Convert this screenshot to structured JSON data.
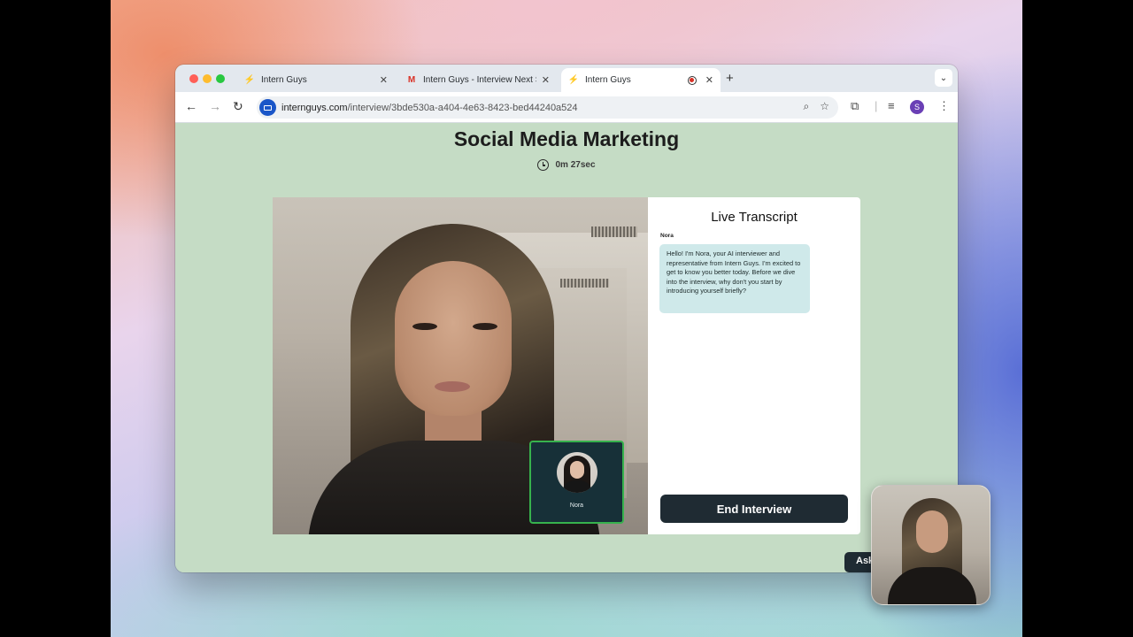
{
  "browser": {
    "tabs": [
      {
        "title": "Intern Guys",
        "favicon": "intern-guys-favicon"
      },
      {
        "title": "Intern Guys - Interview Next S",
        "favicon": "gmail-favicon"
      },
      {
        "title": "Intern Guys",
        "favicon": "intern-guys-favicon",
        "active": true
      }
    ],
    "url_domain": "internguys.com",
    "url_path": "/interview/3bde530a-a404-4e63-8423-bed44240a524",
    "profile_initial": "S"
  },
  "page": {
    "title": "Social Media Marketing",
    "timer": "0m 27sec",
    "ai_tile_name": "Nora",
    "transcript": {
      "heading": "Live Transcript",
      "messages": [
        {
          "speaker": "Nora",
          "text": "Hello! I'm Nora, your AI interviewer and representative from Intern Guys. I'm excited to get to know you better today. Before we dive into the interview, why don't you start by introducing yourself briefly?"
        }
      ]
    },
    "end_button": "End Interview",
    "ask_button": "Ask"
  },
  "colors": {
    "page_bg": "#c5dcc5",
    "button_dark": "#1f2b33",
    "bubble": "#cfe9ea",
    "pip_border": "#37b24d"
  }
}
